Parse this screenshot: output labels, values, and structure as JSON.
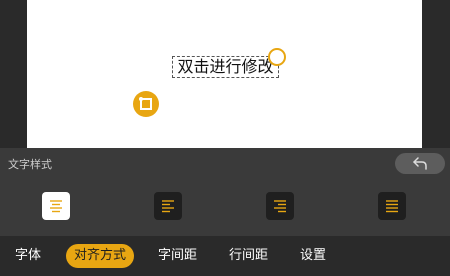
{
  "canvas": {
    "text_content": "双击进行修改"
  },
  "panel": {
    "title": "文字样式",
    "undo_icon": "undo-arrow-icon",
    "align_options": [
      {
        "name": "align-center-icon",
        "selected": true
      },
      {
        "name": "align-left-icon",
        "selected": false
      },
      {
        "name": "align-right-icon",
        "selected": false
      },
      {
        "name": "align-justify-icon",
        "selected": false
      }
    ]
  },
  "tabs": [
    {
      "label": "字体",
      "active": false
    },
    {
      "label": "对齐方式",
      "active": true
    },
    {
      "label": "字间距",
      "active": false
    },
    {
      "label": "行间距",
      "active": false
    },
    {
      "label": "设置",
      "active": false
    }
  ],
  "colors": {
    "accent": "#e8a612",
    "canvas": "#ffffff",
    "panel": "#3a3a3a",
    "background": "#2a2a2a"
  }
}
